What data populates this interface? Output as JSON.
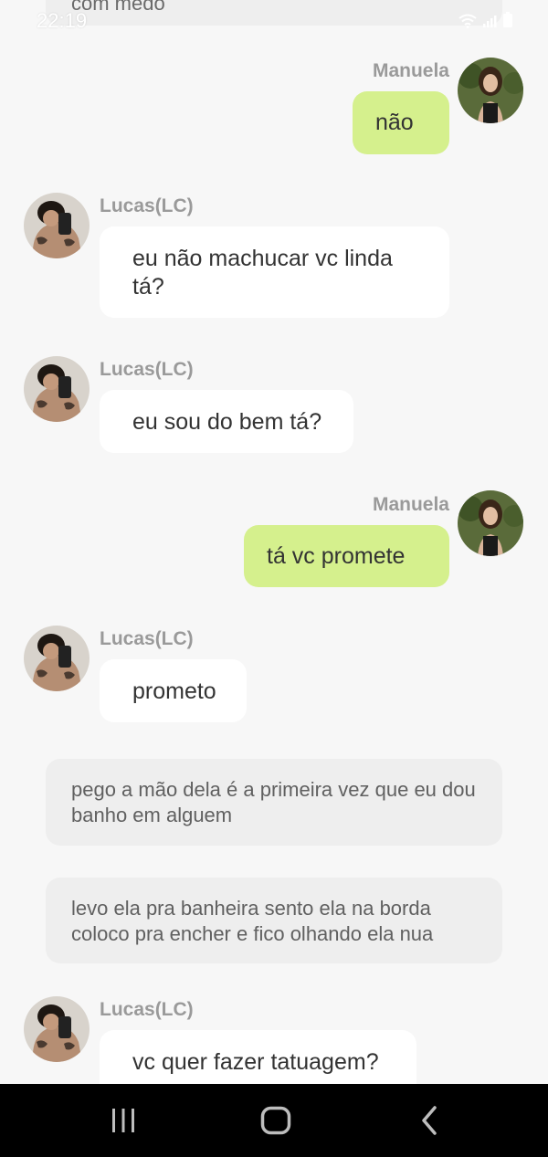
{
  "status_bar": {
    "time": "22:19"
  },
  "top_cut_text": "com medo",
  "messages": [
    {
      "sender": "Manuela",
      "text": "não"
    },
    {
      "sender": "Lucas(LC)",
      "text": "eu não machucar vc linda tá?"
    },
    {
      "sender": "Lucas(LC)",
      "text": "eu sou do bem tá?"
    },
    {
      "sender": "Manuela",
      "text": "tá vc promete"
    },
    {
      "sender": "Lucas(LC)",
      "text": "prometo"
    },
    {
      "sender": "Lucas(LC)",
      "text": "vc quer fazer tatuagem?"
    }
  ],
  "narrations": [
    "pego a mão dela é a primeira vez que eu dou banho em alguem",
    "levo ela pra banheira sento ela na borda coloco pra encher e fico olhando ela nua"
  ],
  "colors": {
    "background": "#f7f7f7",
    "incoming_bubble": "#ffffff",
    "outgoing_bubble": "#d5f08d",
    "narration_bubble": "#eeeeee",
    "name_text": "#9a9a9a",
    "nav_bar": "#000000"
  },
  "icons": {
    "status": [
      "wifi-icon",
      "signal-icon",
      "battery-icon"
    ],
    "navigation": [
      "recent-apps-icon",
      "home-icon",
      "back-icon"
    ]
  }
}
